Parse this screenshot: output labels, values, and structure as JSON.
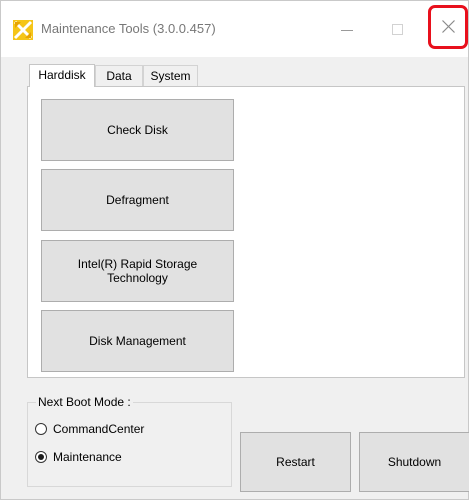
{
  "window": {
    "title": "Maintenance Tools (3.0.0.457)",
    "icon": "maintenance-tools-app-icon",
    "controls": {
      "minimize": "minimize-icon",
      "maximize": "maximize-icon",
      "close": "close-icon"
    },
    "close_highlight_color": "#e8101c"
  },
  "tabs": [
    {
      "label": "Harddisk",
      "active": true
    },
    {
      "label": "Data",
      "active": false
    },
    {
      "label": "System",
      "active": false
    }
  ],
  "harddisk_panel": {
    "buttons": [
      {
        "label": "Check Disk"
      },
      {
        "label": "Defragment"
      },
      {
        "label": "Intel(R) Rapid Storage\nTechnology"
      },
      {
        "label": "Disk Management"
      }
    ]
  },
  "boot_mode": {
    "label": "Next Boot Mode :",
    "options": [
      {
        "label": "CommandCenter",
        "selected": false
      },
      {
        "label": "Maintenance",
        "selected": true
      }
    ]
  },
  "actions": {
    "restart": "Restart",
    "shutdown": "Shutdown"
  }
}
